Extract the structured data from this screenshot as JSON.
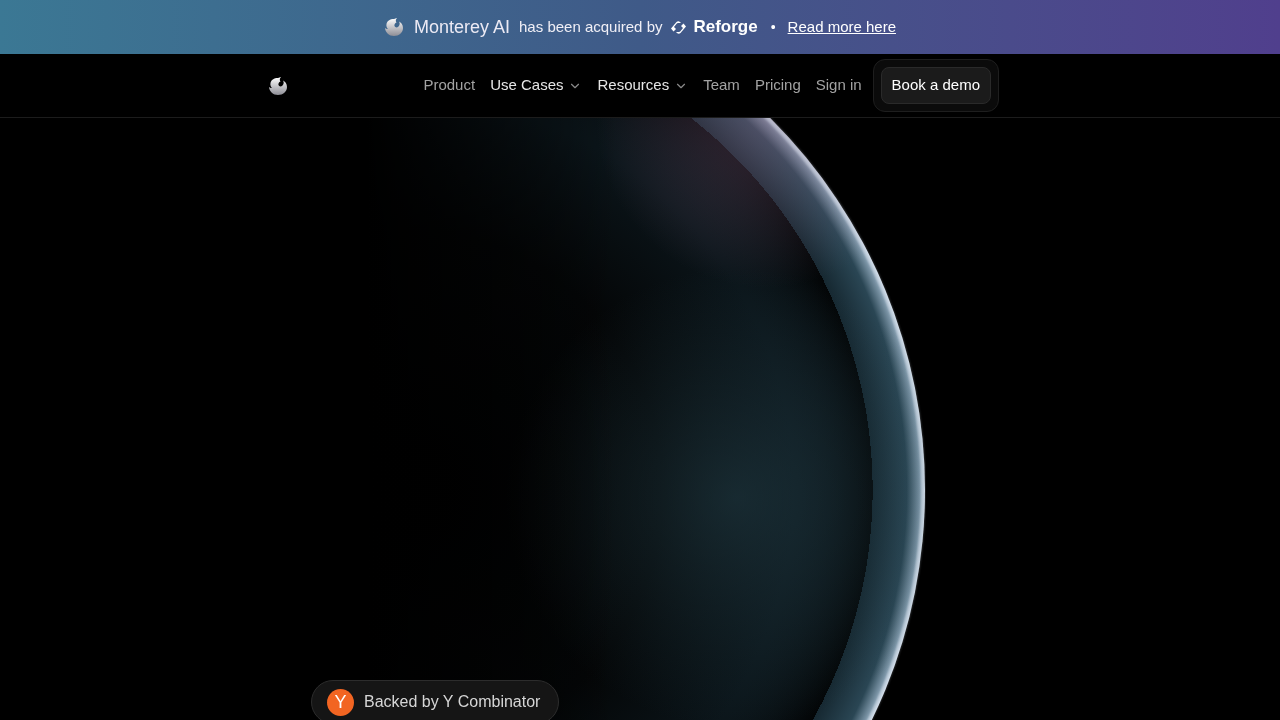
{
  "banner": {
    "company": "Monterey AI",
    "message": "has been acquired by",
    "acquirer": "Reforge",
    "separator": "•",
    "link": "Read more here"
  },
  "nav": {
    "links": [
      {
        "label": "Product",
        "kind": "link"
      },
      {
        "label": "Use Cases",
        "kind": "dropdown"
      },
      {
        "label": "Resources",
        "kind": "dropdown"
      },
      {
        "label": "Team",
        "kind": "link"
      },
      {
        "label": "Pricing",
        "kind": "link"
      },
      {
        "label": "Sign in",
        "kind": "link"
      }
    ],
    "cta": "Book a demo"
  },
  "hero": {
    "badge": {
      "logo_letter": "Y",
      "label": "Backed by Y Combinator"
    }
  }
}
